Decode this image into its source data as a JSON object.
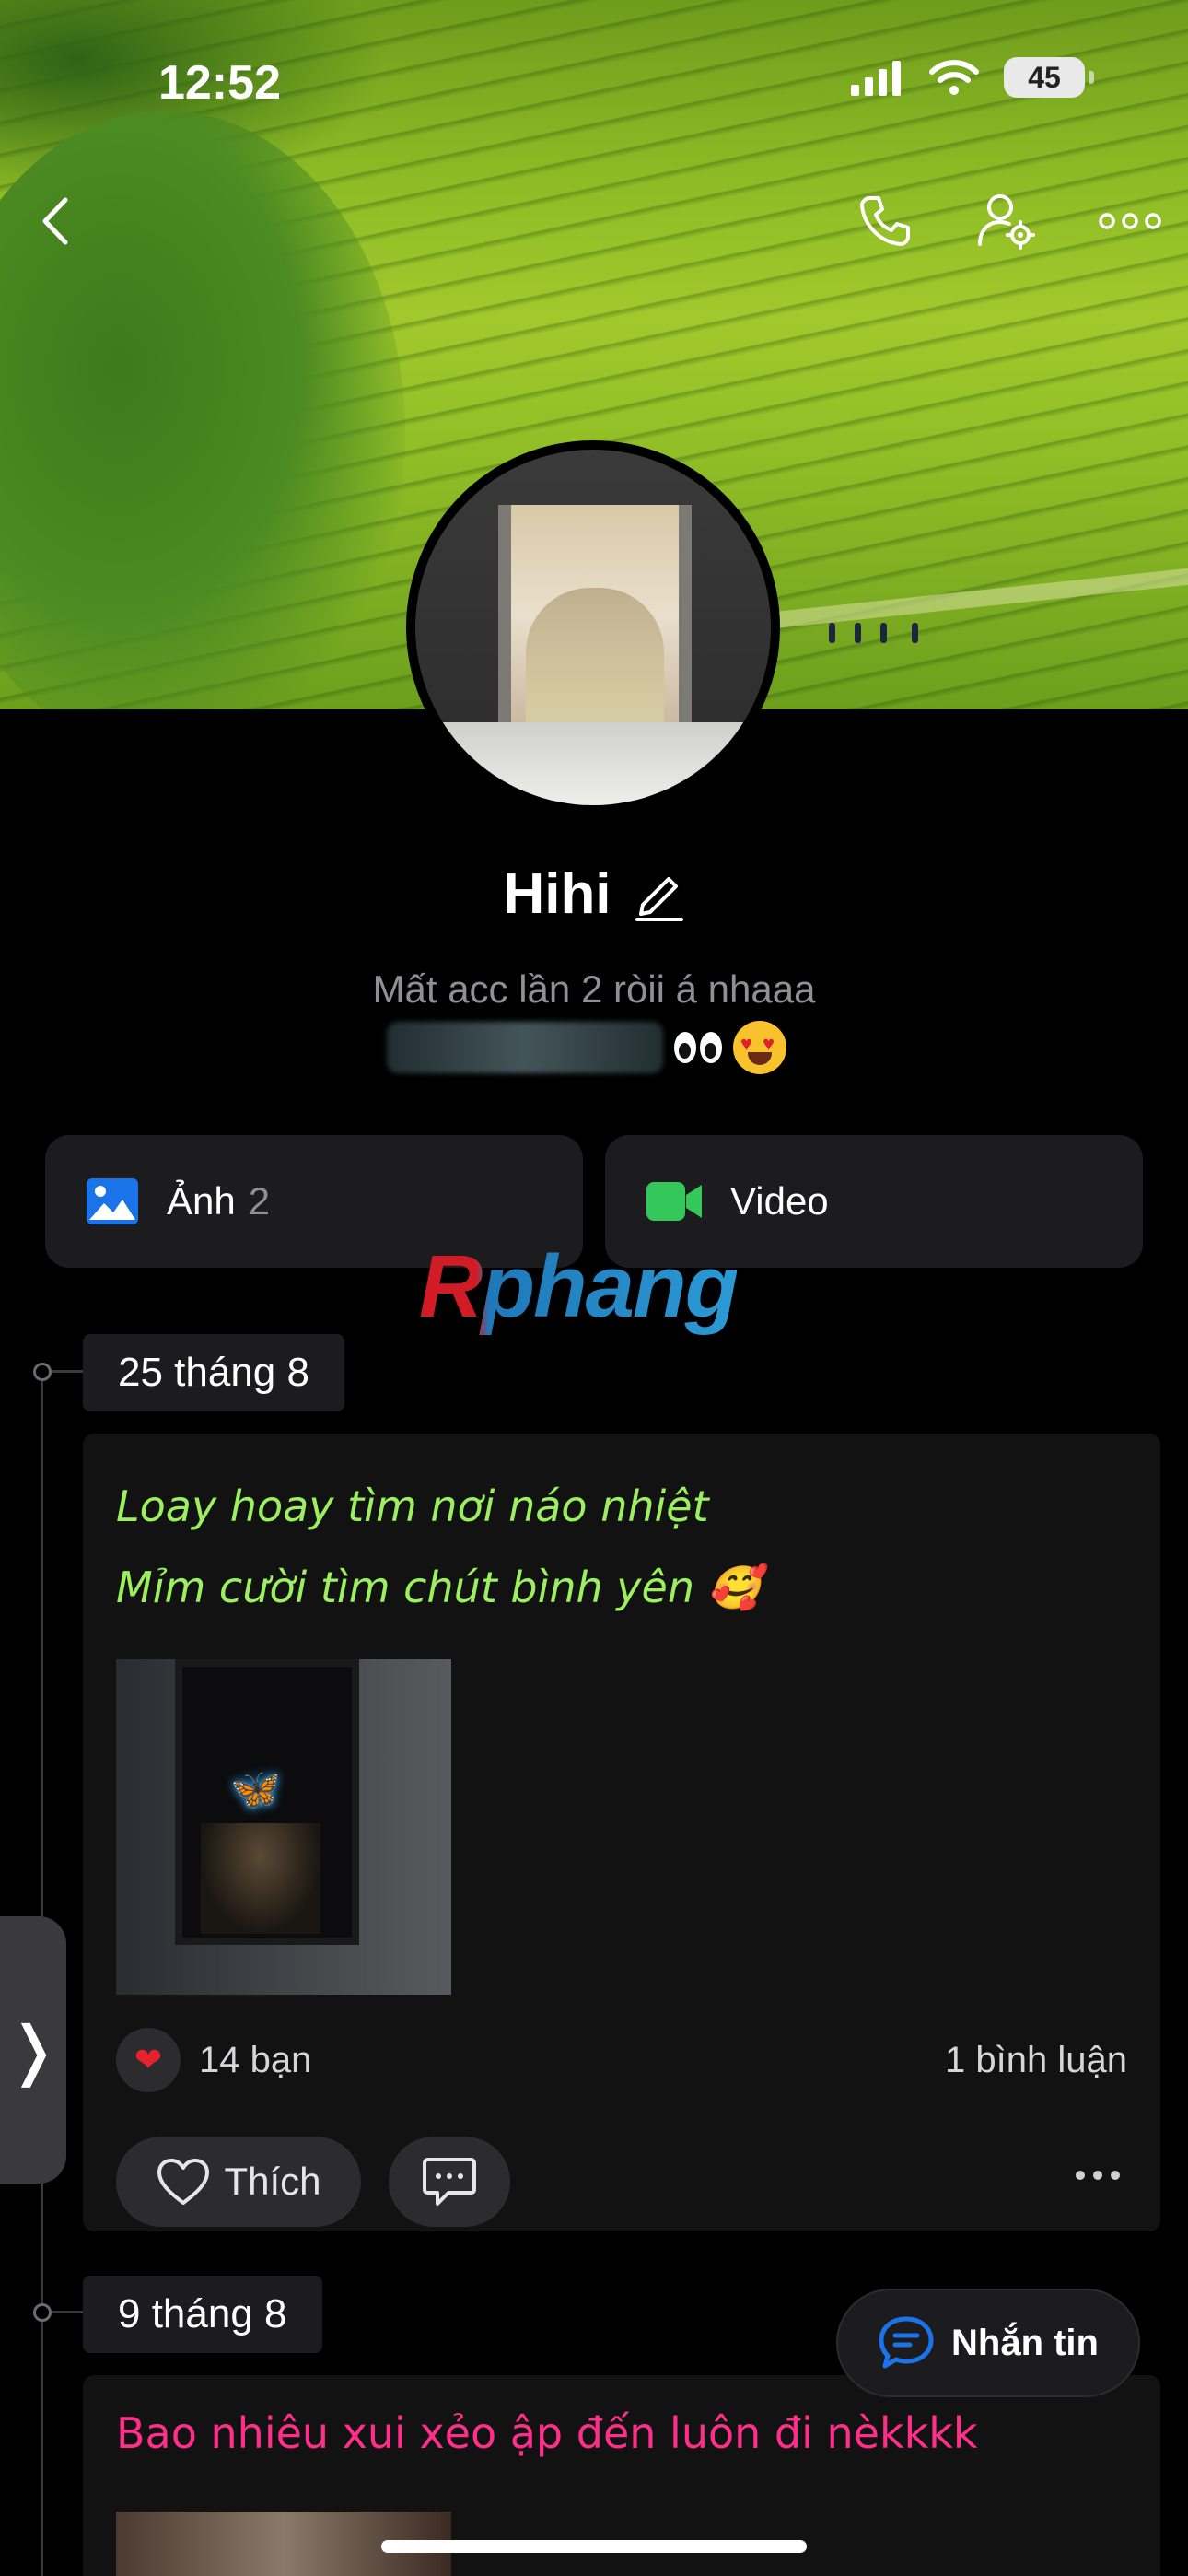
{
  "status_bar": {
    "time": "12:52",
    "battery": "45"
  },
  "profile": {
    "name": "Hihi",
    "bio_line1": "Mất acc lần 2 ròii á nhaaa"
  },
  "media": {
    "photos_label": "Ảnh",
    "photos_count": "2",
    "video_label": "Video"
  },
  "watermark": "Rphang",
  "posts": [
    {
      "date": "25 tháng 8",
      "text_line1": "Loay hoay tìm nơi náo nhiệt",
      "text_line2": "Mỉm cười tìm chút bình yên 🥰",
      "text_color": "#9cf05f",
      "likes": "14 bạn",
      "comments": "1 bình luận",
      "like_label": "Thích"
    },
    {
      "date": "9 tháng 8",
      "text_line1": "Bao nhiêu xui xẻo ập đến luôn đi nèkkkk",
      "text_color": "#ff2e8a"
    }
  ],
  "message_button": "Nhắn tin",
  "icons": {
    "back": "chevron-left-icon",
    "call": "phone-icon",
    "settings": "user-settings-icon",
    "more": "more-icon",
    "photos": "image-icon",
    "video": "video-camera-icon",
    "heart": "heart-icon",
    "comment": "comment-icon",
    "message": "chat-bubble-icon"
  },
  "colors": {
    "accent_blue": "#1a73e8",
    "video_green": "#34c759",
    "like_red": "#e8212f"
  }
}
